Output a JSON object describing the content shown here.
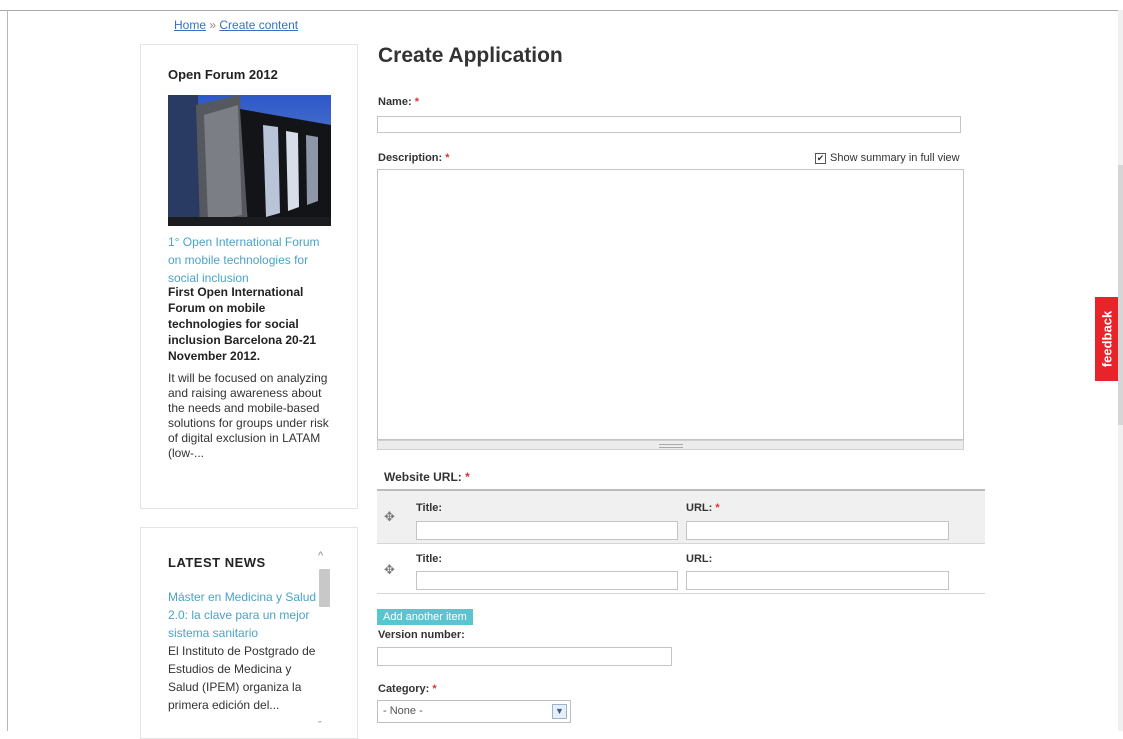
{
  "breadcrumb": {
    "home": "Home",
    "sep": " » ",
    "current": "Create content"
  },
  "forum": {
    "title": "Open Forum 2012",
    "link": "1° Open International Forum on mobile technologies for social inclusion",
    "headline": "First Open International Forum on mobile technologies for social inclusion Barcelona 20-21 November 2012.",
    "body": "It will be focused on analyzing and raising awareness about the needs and mobile-based solutions for groups under risk of digital exclusion in LATAM (low-..."
  },
  "news": {
    "title": "LATEST NEWS",
    "items": [
      {
        "link": "Máster en Medicina y Salud 2.0: la clave para un mejor sistema sanitario",
        "text": "El Instituto de Postgrado de Estudios de Medicina y Salud (IPEM) organiza la primera edición del..."
      }
    ]
  },
  "form": {
    "title": "Create Application",
    "name_label": "Name:",
    "required_mark": "*",
    "name_value": "",
    "description_label": "Description:",
    "summary_label": "Show summary in full view",
    "summary_checked": "✔",
    "website_label": "Website URL:",
    "rows": [
      {
        "title_label": "Title:",
        "url_label": "URL:",
        "url_required": "*",
        "title_value": "",
        "url_value": ""
      },
      {
        "title_label": "Title:",
        "url_label": "URL:",
        "url_required": "",
        "title_value": "",
        "url_value": ""
      }
    ],
    "add_item": "Add another item",
    "version_label": "Version number:",
    "version_value": "",
    "category_label": "Category:",
    "category_value": "- None -"
  },
  "feedback": "feedback",
  "icons": {
    "drag": "✥",
    "arrow_up": "^",
    "arrow_down": "ˇ",
    "select_arrow": "▼"
  }
}
